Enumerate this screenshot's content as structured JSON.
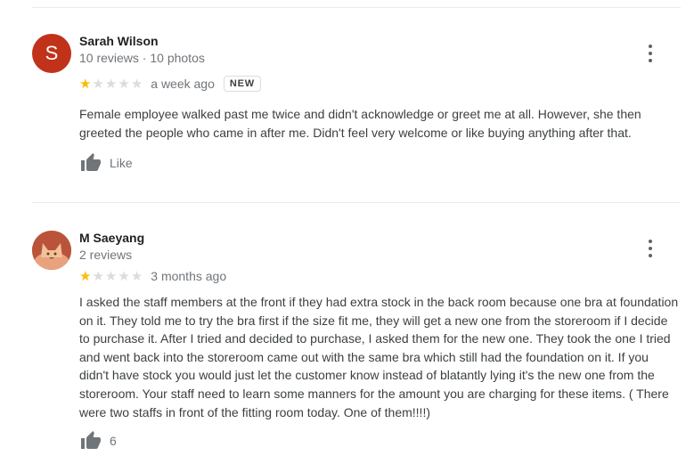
{
  "reviews": [
    {
      "author": "Sarah Wilson",
      "avatar_letter": "S",
      "meta": "10 reviews · 10 photos",
      "rating": 1,
      "max_rating": 5,
      "time": "a week ago",
      "badge": "NEW",
      "text": "Female employee walked past me twice and didn't acknowledge or greet me at all. However, she then greeted the people who came in after me. Didn't feel very welcome or like buying anything after that.",
      "like_label": "Like",
      "avatar_color": "#c1321b"
    },
    {
      "author": "M Saeyang",
      "meta": "2 reviews",
      "rating": 1,
      "max_rating": 5,
      "time": "3 months ago",
      "text": "I asked the staff members at the front if they had extra stock in the back room because one bra at foundation on it. They told me to try the bra first if the size fit me, they will get a new one from the storeroom if I decide to purchase it. After I tried and decided to purchase, I asked them for the new one. They took the one I tried and went back into the storeroom came out with the same bra which still had the foundation on it. If you didn't have stock you would just let the customer know instead of blatantly lying it's the new one from the storeroom. Your staff need to learn some manners for the amount you are charging for these items. ( There were two staffs in front of the fitting room today. One of them!!!!)",
      "like_label": "6"
    }
  ],
  "colors": {
    "star_on": "#fbbc04",
    "star_off": "#dadce0",
    "icon": "#70757a"
  }
}
